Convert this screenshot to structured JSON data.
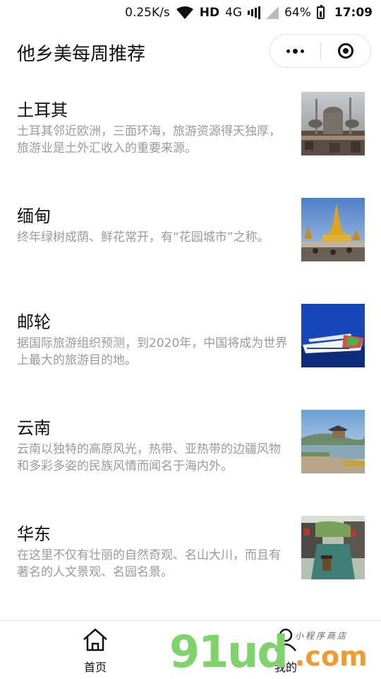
{
  "status_bar": {
    "speed": "0.25K/s",
    "hd": "HD",
    "network": "4G",
    "battery": "64%",
    "time": "17:09"
  },
  "nav": {
    "title": "他乡美每周推荐"
  },
  "items": [
    {
      "title": "土耳其",
      "desc": "土耳其邻近欧洲，三面环海，旅游资源得天独厚，旅游业是土外汇收入的重要来源。",
      "image": "istanbul-mosque-photo"
    },
    {
      "title": "缅甸",
      "desc": "终年绿树成荫、鲜花常开，有“花园城市”之称。",
      "image": "golden-pagoda-photo"
    },
    {
      "title": "邮轮",
      "desc": "据国际旅游组织预测，到2020年，中国将成为世界上最大的旅游目的地。",
      "image": "cruise-ship-photo"
    },
    {
      "title": "云南",
      "desc": "云南以独特的高原风光，热带、亚热带的边疆风物和多彩多姿的民族风情而闻名于海内外。",
      "image": "yunnan-lake-photo"
    },
    {
      "title": "华东",
      "desc": "在这里不仅有壮丽的自然奇观、名山大川，而且有著名的人文景观、名园名景。",
      "image": "water-town-photo"
    }
  ],
  "tabbar": {
    "home_label": "首页",
    "mine_label": "我的"
  },
  "watermark": {
    "brand": "91ud",
    "tld": ".com",
    "tagline": "小程序商店"
  }
}
